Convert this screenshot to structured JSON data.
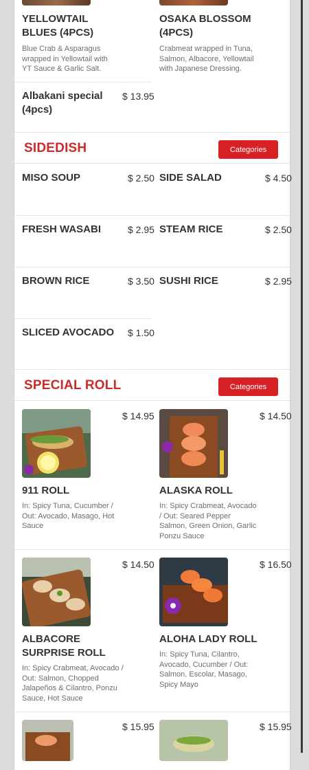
{
  "top_items": [
    {
      "name": "YELLOWTAIL BLUES (4PCS)",
      "desc": "Blue Crab & Asparagus wrapped in Yellowtail with YT Sauce & Garlic Salt."
    },
    {
      "name": "OSAKA BLOSSOM (4PCS)",
      "desc": "Crabmeat wrapped in Tuna, Salmon, Albacore, Yellowtail with Japanese Dressing."
    },
    {
      "name": "Albakani special (4pcs)",
      "price": "$ 13.95"
    }
  ],
  "sidedish": {
    "title": "SIDEDISH",
    "button": "Categories",
    "items": [
      {
        "name": "MISO SOUP",
        "price": "$ 2.50"
      },
      {
        "name": "SIDE SALAD",
        "price": "$ 4.50"
      },
      {
        "name": "FRESH WASABI",
        "price": "$ 2.95"
      },
      {
        "name": "STEAM RICE",
        "price": "$ 2.50"
      },
      {
        "name": "BROWN RICE",
        "price": "$ 3.50"
      },
      {
        "name": "SUSHI RICE",
        "price": "$ 2.95"
      },
      {
        "name": "SLICED AVOCADO",
        "price": "$ 1.50"
      }
    ]
  },
  "special_roll": {
    "title": "SPECIAL ROLL",
    "button": "Categories",
    "items": [
      {
        "name": "911 ROLL",
        "price": "$ 14.95",
        "desc": "In: Spicy Tuna, Cucumber / Out: Avocado, Masago, Hot Sauce"
      },
      {
        "name": "ALASKA ROLL",
        "price": "$ 14.50",
        "desc": "In: Spicy Crabmeat, Avocado / Out: Seared Pepper Salmon, Green Onion, Garlic Ponzu Sauce"
      },
      {
        "name": "ALBACORE SURPRISE ROLL",
        "price": "$ 14.50",
        "desc": "In: Spicy Crabmeat, Avocado / Out: Salmon, Chopped Jalapeños & Cilantro, Ponzu Sauce, Hot Sauce"
      },
      {
        "name": "ALOHA LADY ROLL",
        "price": "$ 16.50",
        "desc": "In: Spicy Tuna, Cilantro, Avocado, Cucumber / Out: Salmon, Escolar, Masago, Spicy Mayo"
      },
      {
        "price": "$ 15.95"
      },
      {
        "price": "$ 15.95"
      }
    ]
  }
}
